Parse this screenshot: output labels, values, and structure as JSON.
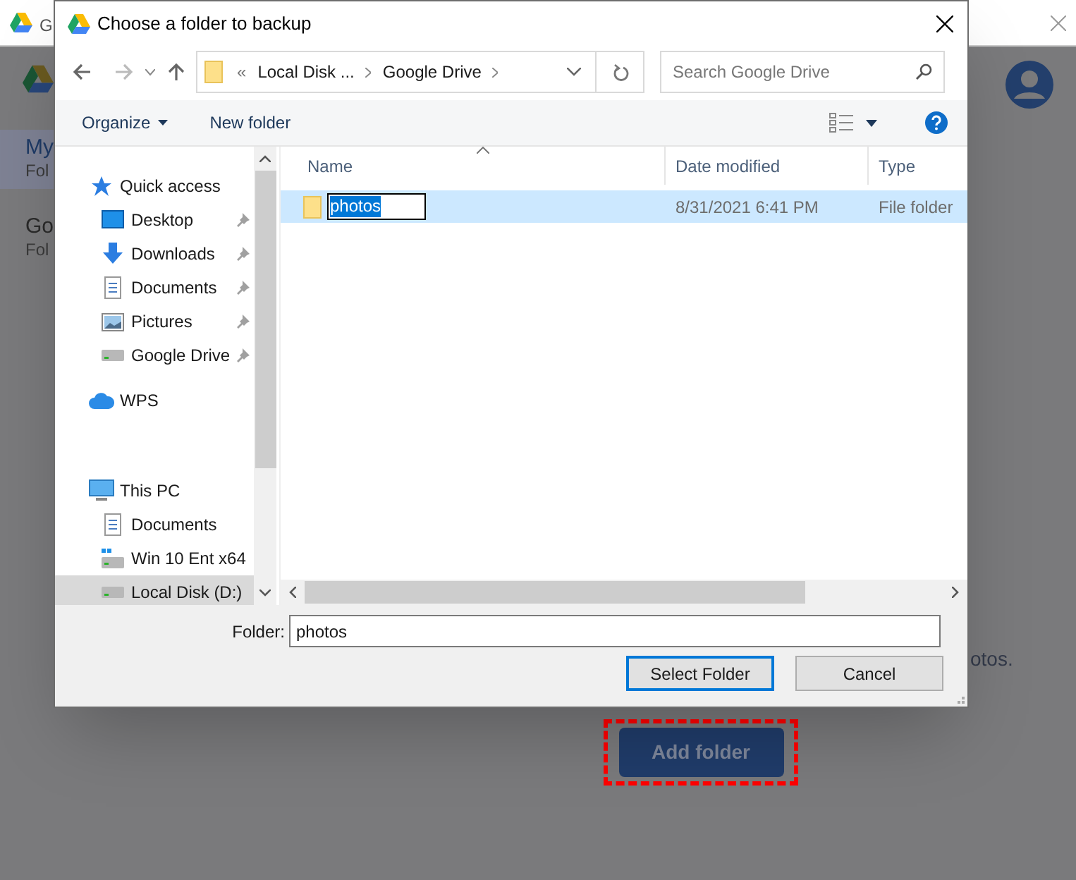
{
  "background_app": {
    "tab_title": "G",
    "sidebar": [
      {
        "title": "My",
        "subtitle": "Fol",
        "selected": true
      },
      {
        "title": "Go",
        "subtitle": "Fol",
        "selected": false
      }
    ],
    "text_fragments": [
      "otos."
    ],
    "button": {
      "label": "Add folder",
      "highlighted": true
    }
  },
  "dialog": {
    "title": "Choose a folder to backup",
    "address": {
      "overflow": "«",
      "segments": [
        "Local Disk ...",
        "Google Drive"
      ]
    },
    "search": {
      "placeholder": "Search Google Drive"
    },
    "toolbar": {
      "organize": "Organize",
      "new_folder": "New folder"
    },
    "nav": [
      {
        "label": "Quick access",
        "kind": "star",
        "pinned": false,
        "selected": false,
        "children": [
          {
            "label": "Desktop",
            "kind": "desktop",
            "pinned": true,
            "selected": false
          },
          {
            "label": "Downloads",
            "kind": "download",
            "pinned": true,
            "selected": false
          },
          {
            "label": "Documents",
            "kind": "document",
            "pinned": true,
            "selected": false
          },
          {
            "label": "Pictures",
            "kind": "picture",
            "pinned": true,
            "selected": false
          },
          {
            "label": "Google Drive",
            "kind": "drive",
            "pinned": true,
            "selected": false
          }
        ]
      },
      {
        "label": "WPS",
        "kind": "cloud",
        "pinned": false,
        "selected": false
      },
      {
        "label": "This PC",
        "kind": "pc",
        "pinned": false,
        "selected": false,
        "children": [
          {
            "label": "Documents",
            "kind": "document",
            "pinned": false,
            "selected": false
          },
          {
            "label": "Win 10 Ent x64",
            "kind": "windrive",
            "pinned": false,
            "selected": false
          },
          {
            "label": "Local Disk (D:)",
            "kind": "drive",
            "pinned": false,
            "selected": true
          }
        ]
      }
    ],
    "columns": [
      {
        "label": "Name",
        "sorted": true
      },
      {
        "label": "Date modified",
        "sorted": false
      },
      {
        "label": "Type",
        "sorted": false
      }
    ],
    "rows": [
      {
        "name": "photos",
        "date_modified": "8/31/2021 6:41 PM",
        "type": "File folder",
        "selected": true,
        "editing": true
      }
    ],
    "folder_label": "Folder:",
    "folder_value": "photos",
    "buttons": [
      {
        "label": "Select Folder",
        "default": true
      },
      {
        "label": "Cancel",
        "default": false
      }
    ]
  }
}
